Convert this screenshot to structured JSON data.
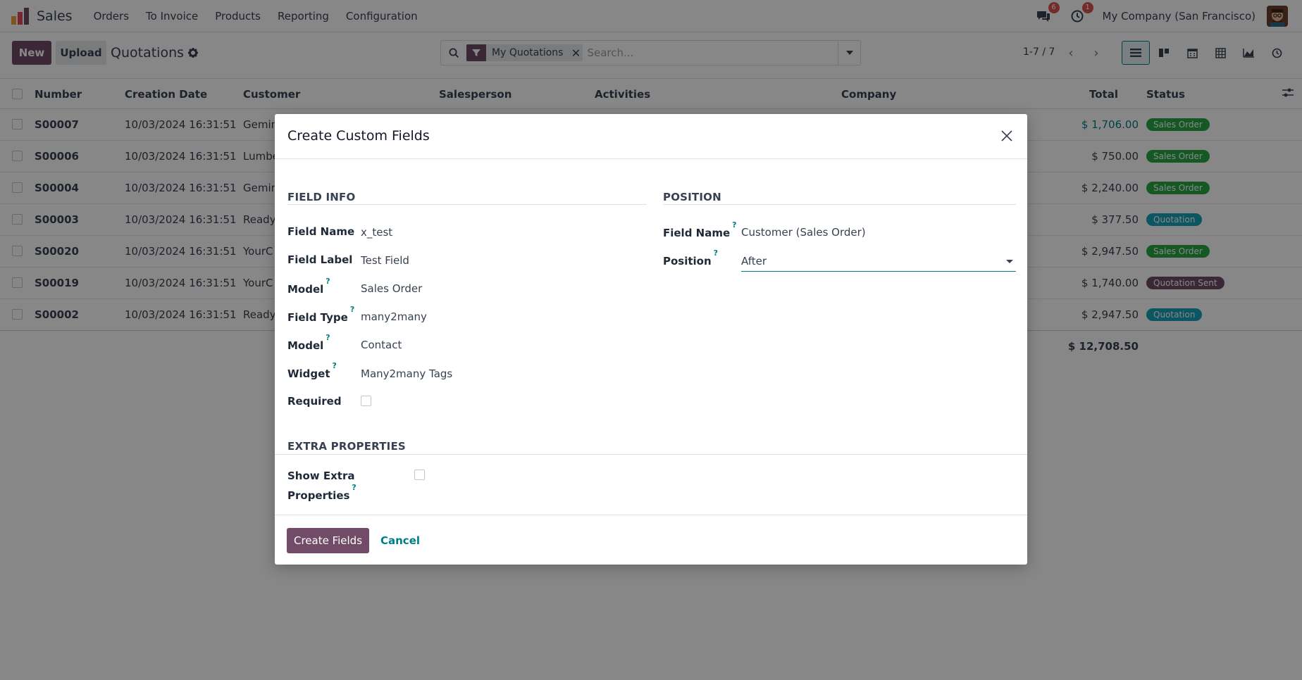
{
  "navbar": {
    "app_name": "Sales",
    "menu": [
      "Orders",
      "To Invoice",
      "Products",
      "Reporting",
      "Configuration"
    ],
    "messages_badge": "6",
    "activities_badge": "1",
    "company": "My Company (San Francisco)"
  },
  "control_panel": {
    "new_label": "New",
    "upload_label": "Upload",
    "title": "Quotations",
    "search": {
      "facet_label": "My Quotations",
      "placeholder": "Search..."
    },
    "pager_value": "1-7 / 7",
    "views": [
      "list-view-icon",
      "kanban-view-icon",
      "calendar-view-icon",
      "pivot-view-icon",
      "graph-view-icon",
      "activity-view-icon"
    ]
  },
  "list": {
    "columns": {
      "number": "Number",
      "creation_date": "Creation Date",
      "customer": "Customer",
      "salesperson": "Salesperson",
      "activities": "Activities",
      "company": "Company",
      "total": "Total",
      "status": "Status"
    },
    "rows": [
      {
        "number": "S00007",
        "date": "10/03/2024 16:31:51",
        "customer": "Gemin",
        "total": "$ 1,706.00",
        "status": "Sales Order"
      },
      {
        "number": "S00006",
        "date": "10/03/2024 16:31:51",
        "customer": "Lumbe",
        "total": "$ 750.00",
        "status": "Sales Order"
      },
      {
        "number": "S00004",
        "date": "10/03/2024 16:31:51",
        "customer": "Gemin",
        "total": "$ 2,240.00",
        "status": "Sales Order"
      },
      {
        "number": "S00003",
        "date": "10/03/2024 16:31:51",
        "customer": "Ready",
        "total": "$ 377.50",
        "status": "Quotation"
      },
      {
        "number": "S00020",
        "date": "10/03/2024 16:31:51",
        "customer": "YourC",
        "total": "$ 2,947.50",
        "status": "Sales Order"
      },
      {
        "number": "S00019",
        "date": "10/03/2024 16:31:51",
        "customer": "YourC",
        "total": "$ 1,740.00",
        "status": "Quotation Sent"
      },
      {
        "number": "S00002",
        "date": "10/03/2024 16:31:51",
        "customer": "Ready",
        "total": "$ 2,947.50",
        "status": "Quotation"
      }
    ],
    "grand_total": "$ 12,708.50"
  },
  "colors": {
    "brand": "#714b67",
    "accent": "#017e84",
    "sales_order": "#28a745",
    "quotation": "#17a2b8",
    "quotation_sent": "#714b67",
    "link_total": "#017e84"
  },
  "dialog": {
    "title": "Create Custom Fields",
    "field_info": {
      "section_title": "FIELD INFO",
      "field_name_label": "Field Name",
      "field_name_value": "x_test",
      "field_label_label": "Field Label",
      "field_label_value": "Test Field",
      "model_label": "Model",
      "model_value": "Sales Order",
      "field_type_label": "Field Type",
      "field_type_value": "many2many",
      "relation_model_label": "Model",
      "relation_model_value": "Contact",
      "widget_label": "Widget",
      "widget_value": "Many2many Tags",
      "required_label": "Required"
    },
    "position": {
      "section_title": "POSITION",
      "field_name_label": "Field Name",
      "field_name_value": "Customer (Sales Order)",
      "position_label": "Position",
      "position_value": "After"
    },
    "extra": {
      "section_title": "EXTRA PROPERTIES",
      "show_extra_label_line1": "Show Extra",
      "show_extra_label_line2": "Properties"
    },
    "help_mark": "?",
    "create_label": "Create Fields",
    "cancel_label": "Cancel"
  }
}
